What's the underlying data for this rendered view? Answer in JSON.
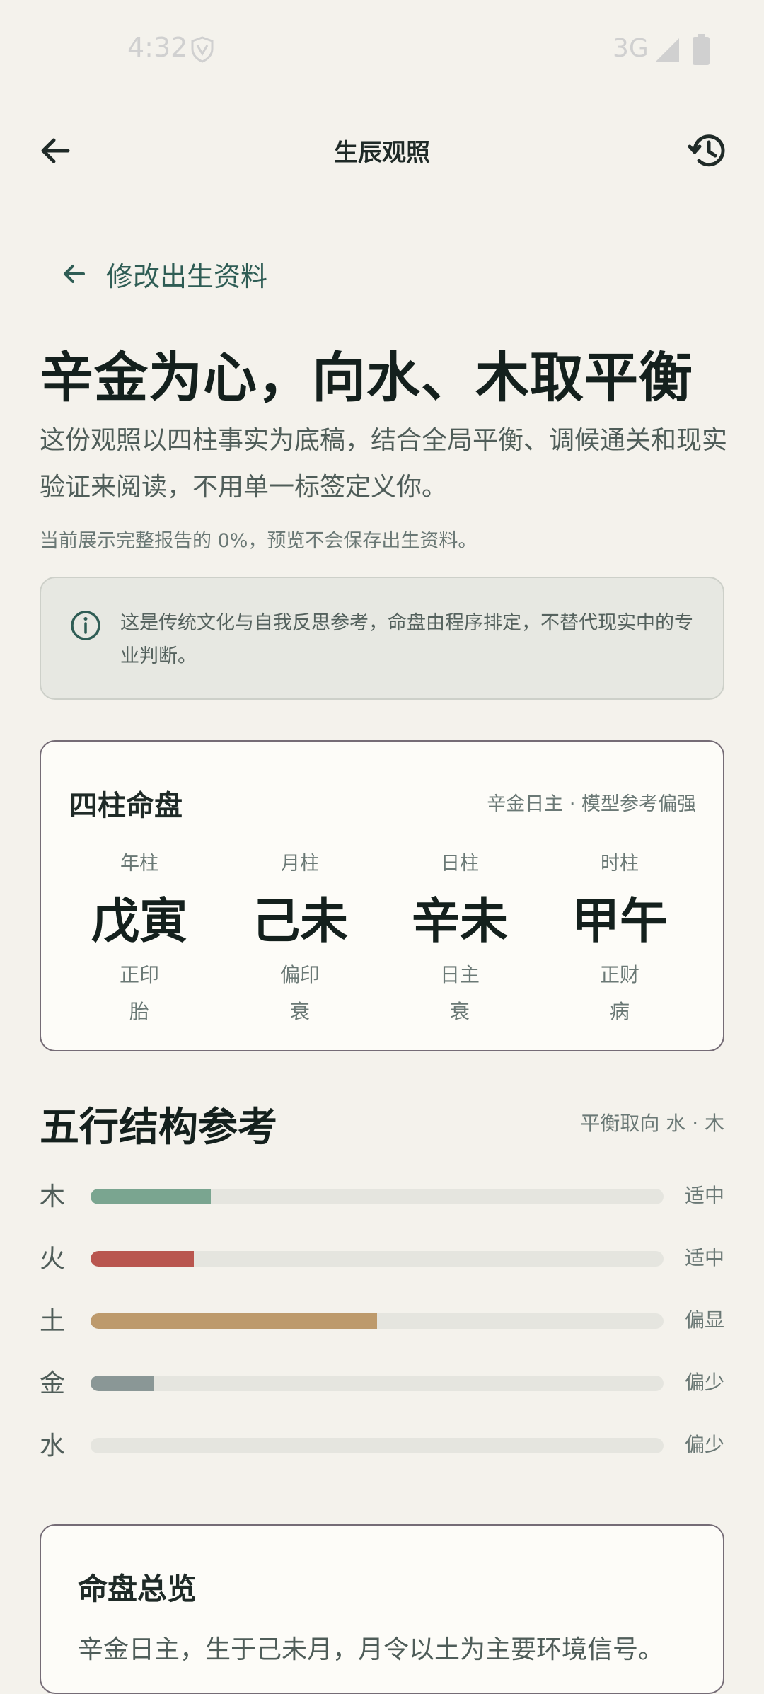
{
  "status_bar": {
    "time": "4:32",
    "network": "3G"
  },
  "top_bar": {
    "title": "生辰观照"
  },
  "edit_link": {
    "label": "修改出生资料"
  },
  "hero": {
    "title": "辛金为心，向水、木取平衡",
    "subtitle": "这份观照以四柱事实为底稿，结合全局平衡、调候通关和现实验证来阅读，不用单一标签定义你。",
    "preview_note": "当前展示完整报告的 0%，预览不会保存出生资料。"
  },
  "disclaimer": {
    "text": "这是传统文化与自我反思参考，命盘由程序排定，不替代现实中的专业判断。"
  },
  "pillars": {
    "title": "四柱命盘",
    "meta": "辛金日主 · 模型参考偏强",
    "items": [
      {
        "label": "年柱",
        "stem": "戊寅",
        "god": "正印",
        "stage": "胎"
      },
      {
        "label": "月柱",
        "stem": "己未",
        "god": "偏印",
        "stage": "衰"
      },
      {
        "label": "日柱",
        "stem": "辛未",
        "god": "日主",
        "stage": "衰"
      },
      {
        "label": "时柱",
        "stem": "甲午",
        "god": "正财",
        "stage": "病"
      }
    ]
  },
  "elements": {
    "title": "五行结构参考",
    "meta": "平衡取向 水 · 木",
    "items": [
      {
        "name": "木",
        "status": "适中",
        "level": 0.21,
        "color": "#7AA590"
      },
      {
        "name": "火",
        "status": "适中",
        "level": 0.18,
        "color": "#B9564F"
      },
      {
        "name": "土",
        "status": "偏显",
        "level": 0.5,
        "color": "#BD9A6C"
      },
      {
        "name": "金",
        "status": "偏少",
        "level": 0.11,
        "color": "#8A9796"
      },
      {
        "name": "水",
        "status": "偏少",
        "level": 0.0,
        "color": "#8A9796"
      }
    ]
  },
  "overview": {
    "title": "命盘总览",
    "text": "辛金日主，生于己未月，月令以土为主要环境信号。"
  }
}
